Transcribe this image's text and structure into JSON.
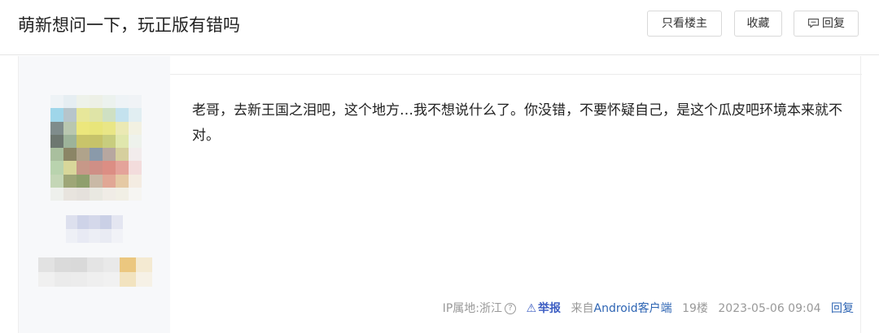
{
  "thread": {
    "title": "萌新想问一下，玩正版有错吗"
  },
  "header_buttons": {
    "only_op": "只看楼主",
    "collect": "收藏",
    "reply": "回复",
    "reply_icon": "comment-icon"
  },
  "post": {
    "content": "老哥，去新王国之泪吧，这个地方…我不想说什么了。你没错，不要怀疑自己，是这个瓜皮吧环境本来就不对。",
    "footer": {
      "ip_label": "IP属地:浙江",
      "help_icon": "?",
      "report_icon": "⚠",
      "report": "举报",
      "from_prefix": "来自",
      "client": "Android客户端",
      "floor": "19楼",
      "time": "2023-05-06 09:04",
      "reply": "回复"
    }
  },
  "colors": {
    "link": "#2d64b3",
    "report": "#3d5ec3",
    "meta_text": "#999999",
    "sidebar_bg": "#f7f8fa"
  }
}
